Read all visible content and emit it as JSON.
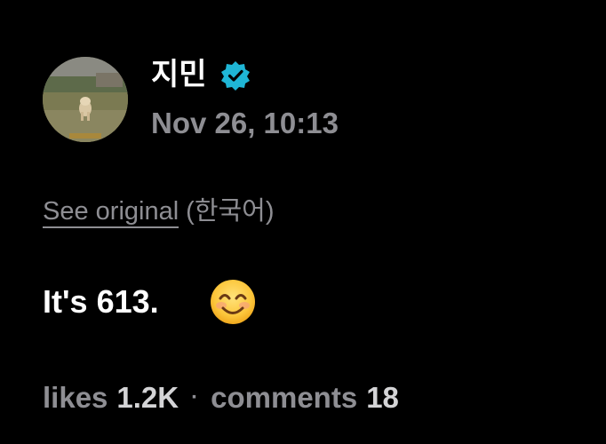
{
  "author": {
    "name": "지민",
    "verified": true,
    "avatar_icon": "dog-photo-avatar"
  },
  "post": {
    "timestamp": "Nov 26, 10:13",
    "see_original_label": "See original",
    "original_language": "(한국어)",
    "text": "It's 613.",
    "emoji": "smiling-face-with-smiling-eyes"
  },
  "stats": {
    "likes_label": "likes",
    "likes_value": "1.2K",
    "separator": "·",
    "comments_label": "comments",
    "comments_value": "18"
  },
  "colors": {
    "background": "#000000",
    "primary_text": "#ffffff",
    "secondary_text": "#8e8e93",
    "verified_badge": "#1fb6d6"
  }
}
